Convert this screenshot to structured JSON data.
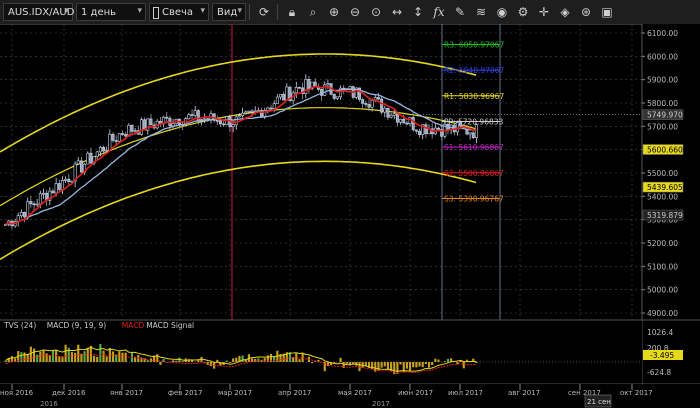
{
  "toolbar": {
    "symbol": "AUS.IDX/AUD",
    "timeframe": "1 день",
    "chart_type": "Свеча",
    "view": "Вид",
    "icons": [
      "refresh-icon",
      "lock-icon",
      "zoom-fit-icon",
      "zoom-in-icon",
      "zoom-out-icon",
      "zoom-reset-icon",
      "scroll-horizontal-icon",
      "scroll-vertical-icon",
      "fx-icon",
      "pencil-icon",
      "layers-icon",
      "eye-icon",
      "settings-icon",
      "crosshair-icon",
      "paint-icon",
      "indicators-icon",
      "screenshot-icon"
    ]
  },
  "colors": {
    "background": "#000000",
    "grid": "#4a4a4a",
    "candle_up": "#c8d8f0",
    "candle_down": "#9aa4b4",
    "red_ma": "#e02020",
    "blue_ma": "#9ab8e0",
    "channel": "#e6d81c",
    "vertical_marker": "#8a1030",
    "r3": "#20c020",
    "r2": "#3040e0",
    "r1": "#e6d81c",
    "pp": "#cccccc",
    "s1": "#c020c0",
    "s2": "#e02020",
    "s3": "#e08020",
    "macd_hist": "#c8a020",
    "macd_hist_green": "#4caf50",
    "macd_line": "#e6d81c",
    "macd_signal": "#e02020"
  },
  "price_axis": {
    "ticks": [
      "6100.00",
      "6000.00",
      "5900.00",
      "5800.00",
      "5700.00",
      "5600.00",
      "5500.00",
      "5400.00",
      "5300.00",
      "5200.00",
      "5100.00",
      "5000.00",
      "4900.00"
    ],
    "labels": [
      {
        "text": "5749.970",
        "value": 5749.97,
        "color": "#cccccc",
        "bg": "#333333"
      },
      {
        "text": "5600.660",
        "value": 5600.66,
        "color": "#000000",
        "bg": "#e6d81c"
      },
      {
        "text": "5439.605",
        "value": 5439.605,
        "color": "#000000",
        "bg": "#e6d81c"
      },
      {
        "text": "5319.879",
        "value": 5319.879,
        "color": "#cccccc",
        "bg": "#222222"
      }
    ]
  },
  "pivots": [
    {
      "text": "R3: 6050.97067",
      "value": 6050.97,
      "key": "r3"
    },
    {
      "text": "R2: 5940.97067",
      "value": 5940.97,
      "key": "r2"
    },
    {
      "text": "R1: 5830.96967",
      "value": 5830.97,
      "key": "r1"
    },
    {
      "text": "PP: 5720.96833",
      "value": 5720.97,
      "key": "pp"
    },
    {
      "text": "S1: 5610.96867",
      "value": 5610.97,
      "key": "s1"
    },
    {
      "text": "S2: 5500.96867",
      "value": 5500.97,
      "key": "s2"
    },
    {
      "text": "S3: 5390.96767",
      "value": 5390.97,
      "key": "s3"
    }
  ],
  "indicator_panel": {
    "legend": [
      "TVS (24)",
      "MACD (9, 19, 9)",
      "MACD",
      "MACD Signal"
    ],
    "ticks": [
      "1026.4",
      "200.8",
      "-624.8"
    ],
    "value_label": "-3.495"
  },
  "x_axis": {
    "months": [
      "ноя 2016",
      "дек 2016",
      "янв 2017",
      "фев 2017",
      "мар 2017",
      "апр 2017",
      "мая 2017",
      "июн 2017",
      "июл 2017",
      "авг 2017",
      "сен 2017",
      "окт 2017"
    ],
    "years": [
      "2016",
      "2017"
    ],
    "crosshair_label": "21 сен"
  },
  "chart_data": {
    "type": "line",
    "title": "",
    "symbol": "AUS.IDX/AUD",
    "timeframe": "1 день",
    "xlabel": "",
    "ylabel": "",
    "ylim": [
      4870,
      6130
    ],
    "x": [
      "ноя 2016",
      "дек 2016",
      "янв 2017",
      "фев 2017",
      "мар 2017",
      "апр 2017",
      "мая 2017",
      "июн 2017",
      "июл 2017"
    ],
    "series": [
      {
        "name": "",
        "values": [
          5280,
          5470,
          5680,
          5740,
          5720,
          5870,
          5840,
          5700,
          5680
        ]
      }
    ],
    "pivot_levels": {
      "R3": 6050.97067,
      "R2": 5940.97067,
      "R1": 5830.96967,
      "PP": 5720.96833,
      "S1": 5610.96867,
      "S2": 5500.96867,
      "S3": 5390.96767
    },
    "last_price": 5749.97,
    "grid": true
  }
}
